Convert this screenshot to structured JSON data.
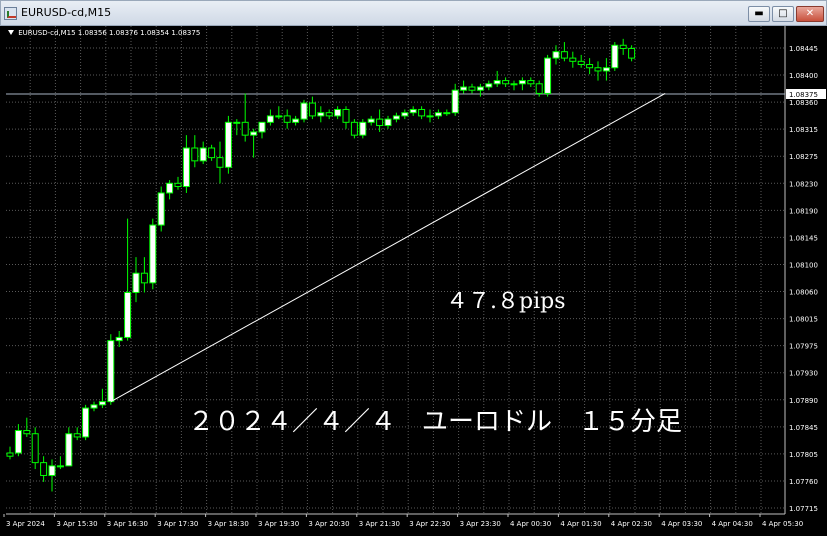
{
  "window": {
    "title": "EURUSD-cd,M15",
    "controls": [
      "minimize-icon",
      "maximize-icon",
      "close-icon"
    ]
  },
  "chart_header": {
    "symbol": "EURUSD-cd,M15",
    "ohlc": "1.08356 1.08376 1.08354 1.08375"
  },
  "annotations": {
    "pips": "４７.８pips",
    "caption": "２０２４／４／４　ユーロドル　１５分足"
  },
  "colors": {
    "background": "#000000",
    "grid": "#5a5a5a",
    "bull_fill": "#ffffff",
    "bear_fill": "#000000",
    "candle_line": "#00ff00",
    "bid_line": "#a7b5c4",
    "trendline": "#ffffff",
    "text": "#ffffff"
  },
  "chart_data": {
    "type": "candlestick",
    "symbol": "EURUSD-cd",
    "timeframe": "M15",
    "current_price": "1.08375",
    "ylim": [
      1.0771,
      1.0847
    ],
    "y_ticks": [
      "1.08445",
      "1.08400",
      "1.08360",
      "1.08315",
      "1.08275",
      "1.08230",
      "1.08190",
      "1.08145",
      "1.08100",
      "1.08060",
      "1.08015",
      "1.07975",
      "1.07930",
      "1.07890",
      "1.07845",
      "1.07805",
      "1.07760",
      "1.07715"
    ],
    "x_ticks": [
      {
        "i": 0,
        "label": "3 Apr 2024"
      },
      {
        "i": 6,
        "label": "3 Apr 15:30"
      },
      {
        "i": 12,
        "label": "3 Apr 16:30"
      },
      {
        "i": 18,
        "label": "3 Apr 17:30"
      },
      {
        "i": 24,
        "label": "3 Apr 18:30"
      },
      {
        "i": 30,
        "label": "3 Apr 19:30"
      },
      {
        "i": 36,
        "label": "3 Apr 20:30"
      },
      {
        "i": 42,
        "label": "3 Apr 21:30"
      },
      {
        "i": 48,
        "label": "3 Apr 22:30"
      },
      {
        "i": 54,
        "label": "3 Apr 23:30"
      },
      {
        "i": 60,
        "label": "4 Apr 00:30"
      },
      {
        "i": 66,
        "label": "4 Apr 01:30"
      },
      {
        "i": 72,
        "label": "4 Apr 02:30"
      },
      {
        "i": 78,
        "label": "4 Apr 03:30"
      },
      {
        "i": 84,
        "label": "4 Apr 04:30"
      },
      {
        "i": 90,
        "label": "4 Apr 05:30"
      }
    ],
    "candles": [
      [
        1.07805,
        1.07815,
        1.07795,
        1.078
      ],
      [
        1.07805,
        1.0785,
        1.078,
        1.0784
      ],
      [
        1.0784,
        1.0786,
        1.0783,
        1.07835
      ],
      [
        1.07835,
        1.07845,
        1.0778,
        1.0779
      ],
      [
        1.0779,
        1.078,
        1.0776,
        1.0777
      ],
      [
        1.0777,
        1.07795,
        1.07745,
        1.07785
      ],
      [
        1.07785,
        1.078,
        1.0778,
        1.07785
      ],
      [
        1.07785,
        1.07845,
        1.07785,
        1.07835
      ],
      [
        1.07835,
        1.07845,
        1.07825,
        1.0783
      ],
      [
        1.0783,
        1.0788,
        1.07825,
        1.07875
      ],
      [
        1.07875,
        1.07885,
        1.0787,
        1.0788
      ],
      [
        1.0788,
        1.07905,
        1.07875,
        1.07885
      ],
      [
        1.07885,
        1.0799,
        1.0788,
        1.0798
      ],
      [
        1.0798,
        1.07995,
        1.0797,
        1.07985
      ],
      [
        1.07985,
        1.0817,
        1.0798,
        1.08055
      ],
      [
        1.08055,
        1.0811,
        1.0804,
        1.08085
      ],
      [
        1.08085,
        1.0811,
        1.08055,
        1.0807
      ],
      [
        1.0807,
        1.0817,
        1.0806,
        1.0816
      ],
      [
        1.0816,
        1.0822,
        1.0815,
        1.0821
      ],
      [
        1.0821,
        1.0823,
        1.082,
        1.08225
      ],
      [
        1.08225,
        1.08235,
        1.08215,
        1.0822
      ],
      [
        1.0822,
        1.083,
        1.0821,
        1.0828
      ],
      [
        1.0828,
        1.083,
        1.0825,
        1.0826
      ],
      [
        1.0826,
        1.0829,
        1.08255,
        1.0828
      ],
      [
        1.0828,
        1.08285,
        1.0826,
        1.08265
      ],
      [
        1.08265,
        1.0829,
        1.08225,
        1.0825
      ],
      [
        1.0825,
        1.0833,
        1.0824,
        1.0832
      ],
      [
        1.0832,
        1.08325,
        1.083,
        1.0832
      ],
      [
        1.0832,
        1.08365,
        1.0829,
        1.083
      ],
      [
        1.083,
        1.0831,
        1.08265,
        1.08305
      ],
      [
        1.08305,
        1.0832,
        1.08295,
        1.0832
      ],
      [
        1.0832,
        1.0834,
        1.08315,
        1.0833
      ],
      [
        1.0833,
        1.08345,
        1.08325,
        1.0833
      ],
      [
        1.0833,
        1.0834,
        1.0831,
        1.0832
      ],
      [
        1.0832,
        1.0833,
        1.08315,
        1.08325
      ],
      [
        1.08325,
        1.08355,
        1.0832,
        1.0835
      ],
      [
        1.0835,
        1.0836,
        1.08325,
        1.0833
      ],
      [
        1.0833,
        1.08345,
        1.0832,
        1.08335
      ],
      [
        1.08335,
        1.0834,
        1.08325,
        1.0833
      ],
      [
        1.0833,
        1.08345,
        1.08325,
        1.0834
      ],
      [
        1.0834,
        1.08345,
        1.0831,
        1.0832
      ],
      [
        1.0832,
        1.08325,
        1.08295,
        1.083
      ],
      [
        1.083,
        1.08325,
        1.08295,
        1.0832
      ],
      [
        1.0832,
        1.0833,
        1.08315,
        1.08325
      ],
      [
        1.08325,
        1.0834,
        1.08305,
        1.08315
      ],
      [
        1.08315,
        1.0833,
        1.0831,
        1.08325
      ],
      [
        1.08325,
        1.08335,
        1.0832,
        1.0833
      ],
      [
        1.0833,
        1.0834,
        1.08325,
        1.08335
      ],
      [
        1.08335,
        1.08345,
        1.0833,
        1.0834
      ],
      [
        1.0834,
        1.08345,
        1.08325,
        1.0833
      ],
      [
        1.0833,
        1.0834,
        1.0832,
        1.0833
      ],
      [
        1.0833,
        1.0834,
        1.08325,
        1.08335
      ],
      [
        1.08335,
        1.0834,
        1.0833,
        1.08335
      ],
      [
        1.08335,
        1.0838,
        1.0833,
        1.0837
      ],
      [
        1.0837,
        1.08385,
        1.08365,
        1.08375
      ],
      [
        1.08375,
        1.0838,
        1.08365,
        1.0837
      ],
      [
        1.0837,
        1.0838,
        1.0836,
        1.08375
      ],
      [
        1.08375,
        1.08385,
        1.0837,
        1.0838
      ],
      [
        1.0838,
        1.084,
        1.08375,
        1.08385
      ],
      [
        1.08385,
        1.0839,
        1.08375,
        1.0838
      ],
      [
        1.0838,
        1.08385,
        1.0837,
        1.0838
      ],
      [
        1.0838,
        1.0839,
        1.0837,
        1.08385
      ],
      [
        1.08385,
        1.0839,
        1.08375,
        1.0838
      ],
      [
        1.0838,
        1.08385,
        1.0836,
        1.08365
      ],
      [
        1.08365,
        1.08425,
        1.0836,
        1.0842
      ],
      [
        1.0842,
        1.0844,
        1.0841,
        1.0843
      ],
      [
        1.0843,
        1.08445,
        1.08415,
        1.0842
      ],
      [
        1.0842,
        1.0843,
        1.08405,
        1.08415
      ],
      [
        1.08415,
        1.08425,
        1.08405,
        1.0841
      ],
      [
        1.0841,
        1.0842,
        1.08395,
        1.08405
      ],
      [
        1.08405,
        1.08415,
        1.08385,
        1.084
      ],
      [
        1.084,
        1.0842,
        1.08385,
        1.08405
      ],
      [
        1.08405,
        1.08445,
        1.084,
        1.0844
      ],
      [
        1.0844,
        1.0845,
        1.08425,
        1.08435
      ],
      [
        1.08435,
        1.0844,
        1.08415,
        1.0842
      ]
    ],
    "trendline": {
      "from": {
        "i": 12,
        "price": 1.07885
      },
      "to": {
        "i": 78,
        "price": 1.08365
      }
    }
  }
}
